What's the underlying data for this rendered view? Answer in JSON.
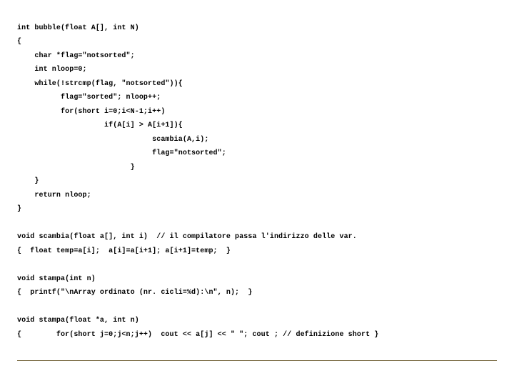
{
  "code": {
    "l01": "int bubble(float A[], int N)",
    "l02": "{",
    "l03": "    char *flag=\"notsorted\";",
    "l04": "    int nloop=0;",
    "l05": "    while(!strcmp(flag, \"notsorted\")){",
    "l06": "          flag=\"sorted\"; nloop++;",
    "l07": "          for(short i=0;i<N-1;i++)",
    "l08": "                    if(A[i] > A[i+1]){",
    "l09": "                               scambia(A,i);",
    "l10": "                               flag=\"notsorted\";",
    "l11": "                          }",
    "l12": "    }",
    "l13": "    return nloop;",
    "l14": "}",
    "l15": "",
    "l16": "void scambia(float a[], int i)  // il compilatore passa l'indirizzo delle var.",
    "l17": "{  float temp=a[i];  a[i]=a[i+1]; a[i+1]=temp;  }",
    "l18": "",
    "l19": "void stampa(int n)",
    "l20": "{  printf(\"\\nArray ordinato (nr. cicli=%d):\\n\", n);  }",
    "l21": "",
    "l22": "void stampa(float *a, int n)",
    "l23": "{        for(short j=0;j<n;j++)  cout << a[j] << \" \"; cout ; // definizione short }"
  }
}
